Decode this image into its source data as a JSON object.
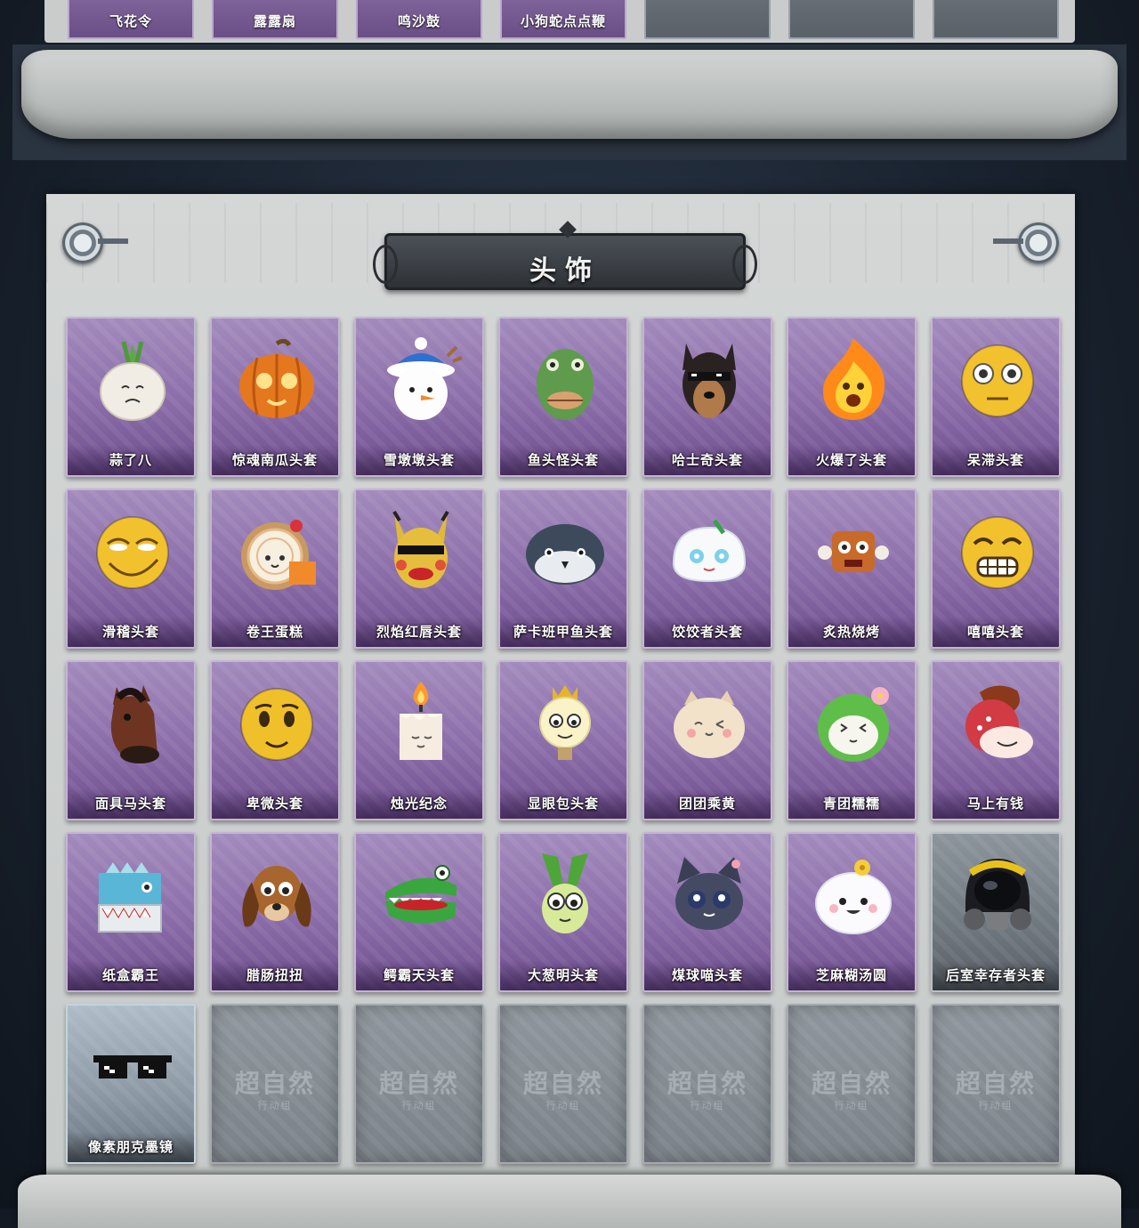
{
  "top_section": {
    "items": [
      {
        "name": "飞花令",
        "rarity": "purple"
      },
      {
        "name": "露露扇",
        "rarity": "purple"
      },
      {
        "name": "鸣沙鼓",
        "rarity": "purple"
      },
      {
        "name": "小狗蛇点点鞭",
        "rarity": "purple"
      },
      {
        "name": "",
        "rarity": "gray"
      },
      {
        "name": "",
        "rarity": "gray"
      },
      {
        "name": "",
        "rarity": "gray"
      }
    ]
  },
  "section": {
    "title": "头饰"
  },
  "items": [
    {
      "name": "蒜了八",
      "icon": "garlic-icon",
      "rarity": "purple"
    },
    {
      "name": "惊魂南瓜头套",
      "icon": "pumpkin-icon",
      "rarity": "purple"
    },
    {
      "name": "雪墩墩头套",
      "icon": "snowman-icon",
      "rarity": "purple"
    },
    {
      "name": "鱼头怪头套",
      "icon": "fish-head-icon",
      "rarity": "purple"
    },
    {
      "name": "哈士奇头套",
      "icon": "husky-icon",
      "rarity": "purple"
    },
    {
      "name": "火爆了头套",
      "icon": "fire-icon",
      "rarity": "purple"
    },
    {
      "name": "呆滞头套",
      "icon": "stunned-face-icon",
      "rarity": "purple"
    },
    {
      "name": "滑稽头套",
      "icon": "funny-face-icon",
      "rarity": "purple"
    },
    {
      "name": "卷王蛋糕",
      "icon": "cake-roll-icon",
      "rarity": "purple"
    },
    {
      "name": "烈焰红唇头套",
      "icon": "pikachu-mask-icon",
      "rarity": "purple"
    },
    {
      "name": "萨卡班甲鱼头套",
      "icon": "sacabambaspis-icon",
      "rarity": "purple"
    },
    {
      "name": "饺饺者头套",
      "icon": "dumpling-icon",
      "rarity": "purple"
    },
    {
      "name": "炙热烧烤",
      "icon": "bbq-meat-icon",
      "rarity": "purple"
    },
    {
      "name": "嘻嘻头套",
      "icon": "grin-face-icon",
      "rarity": "purple"
    },
    {
      "name": "面具马头套",
      "icon": "horse-mask-icon",
      "rarity": "purple"
    },
    {
      "name": "卑微头套",
      "icon": "humble-face-icon",
      "rarity": "purple"
    },
    {
      "name": "烛光纪念",
      "icon": "candle-icon",
      "rarity": "purple"
    },
    {
      "name": "显眼包头套",
      "icon": "lightbulb-icon",
      "rarity": "purple"
    },
    {
      "name": "团团乘黄",
      "icon": "cat-bun-icon",
      "rarity": "purple"
    },
    {
      "name": "青团糯糯",
      "icon": "green-bun-icon",
      "rarity": "purple"
    },
    {
      "name": "马上有钱",
      "icon": "red-horse-icon",
      "rarity": "purple"
    },
    {
      "name": "纸盒霸王",
      "icon": "box-dino-icon",
      "rarity": "purple"
    },
    {
      "name": "腊肠扭扭",
      "icon": "dachshund-icon",
      "rarity": "purple"
    },
    {
      "name": "鳄霸天头套",
      "icon": "crocodile-icon",
      "rarity": "purple"
    },
    {
      "name": "大葱明头套",
      "icon": "scallion-icon",
      "rarity": "purple"
    },
    {
      "name": "煤球喵头套",
      "icon": "black-cat-icon",
      "rarity": "purple"
    },
    {
      "name": "芝麻糊汤圆",
      "icon": "tangyuan-icon",
      "rarity": "purple"
    },
    {
      "name": "后室幸存者头套",
      "icon": "gas-mask-helmet-icon",
      "rarity": "gray"
    },
    {
      "name": "像素朋克墨镜",
      "icon": "pixel-sunglasses-icon",
      "rarity": "ice"
    },
    {
      "name": "",
      "icon": "empty-slot-icon",
      "rarity": "empty"
    },
    {
      "name": "",
      "icon": "empty-slot-icon",
      "rarity": "empty"
    },
    {
      "name": "",
      "icon": "empty-slot-icon",
      "rarity": "empty"
    },
    {
      "name": "",
      "icon": "empty-slot-icon",
      "rarity": "empty"
    },
    {
      "name": "",
      "icon": "empty-slot-icon",
      "rarity": "empty"
    },
    {
      "name": "",
      "icon": "empty-slot-icon",
      "rarity": "empty"
    }
  ],
  "empty_slot": {
    "watermark": "超自然",
    "watermark_sub": "行动组"
  },
  "colors": {
    "purple_card": "#8a6ca8",
    "gray_card": "#6e767e",
    "panel": "#c9ccca",
    "banner": "#2e3237",
    "background": "#1a2330"
  }
}
